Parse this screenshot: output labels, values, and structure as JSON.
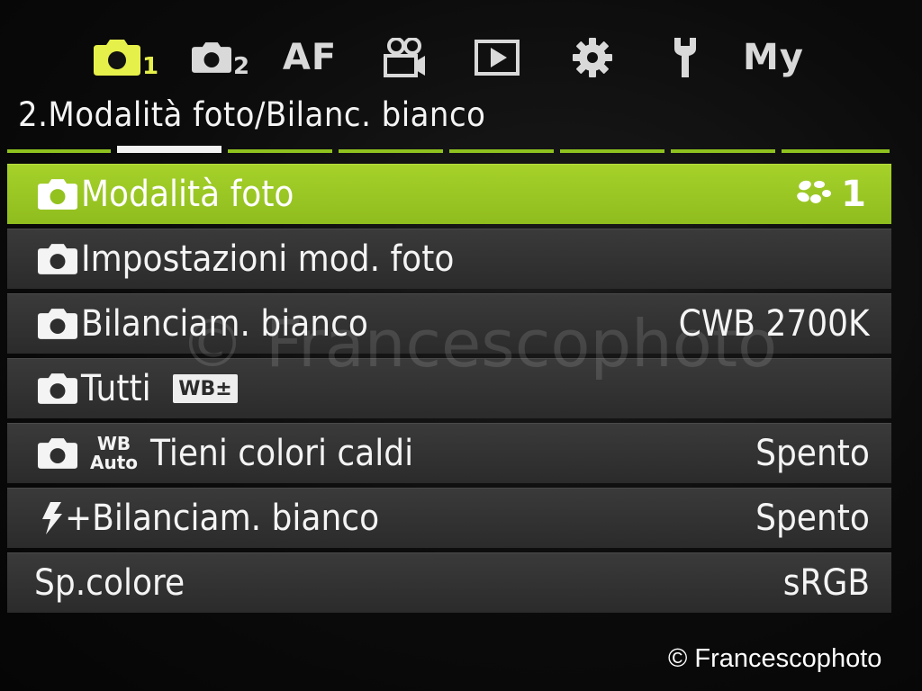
{
  "tabs": [
    {
      "name": "tab-shooting-1",
      "sub": "1",
      "icon": "camera-icon",
      "active": true
    },
    {
      "name": "tab-shooting-2",
      "sub": "2",
      "icon": "camera-icon",
      "active": false
    },
    {
      "name": "tab-af",
      "label": "AF"
    },
    {
      "name": "tab-video",
      "icon": "video-camera-icon"
    },
    {
      "name": "tab-playback",
      "icon": "play-icon"
    },
    {
      "name": "tab-settings",
      "icon": "gear-icon"
    },
    {
      "name": "tab-custom",
      "icon": "wrench-icon"
    },
    {
      "name": "tab-my-menu",
      "label": "My"
    }
  ],
  "section_title": "2.Modalità foto/Bilanc. bianco",
  "progress": {
    "segments": 8,
    "active_index": 1
  },
  "rows": [
    {
      "label": "Modalità foto",
      "value": "1",
      "icon": "camera-icon",
      "value_icon": "picture-mode-icon",
      "selected": true
    },
    {
      "label": "Impostazioni mod. foto",
      "value": "",
      "icon": "camera-icon"
    },
    {
      "label": "Bilanciam. bianco",
      "value": "CWB 2700K",
      "icon": "camera-icon"
    },
    {
      "label": "Tutti",
      "badge": "WB±",
      "value": "",
      "icon": "camera-icon"
    },
    {
      "label": "Tieni colori caldi",
      "value": "Spento",
      "icon": "camera-icon",
      "badge_top": "WB",
      "badge_bottom": "Auto"
    },
    {
      "label": "+Bilanciam. bianco",
      "value": "Spento",
      "icon": "flash-icon"
    },
    {
      "label": "Sp.colore",
      "value": "sRGB"
    }
  ],
  "watermark": "© Francescophoto",
  "credit": "© Francescophoto",
  "colors": {
    "accent_green": "#9ccc24",
    "active_tab": "#e6f04a",
    "row_bg": "#323232"
  }
}
